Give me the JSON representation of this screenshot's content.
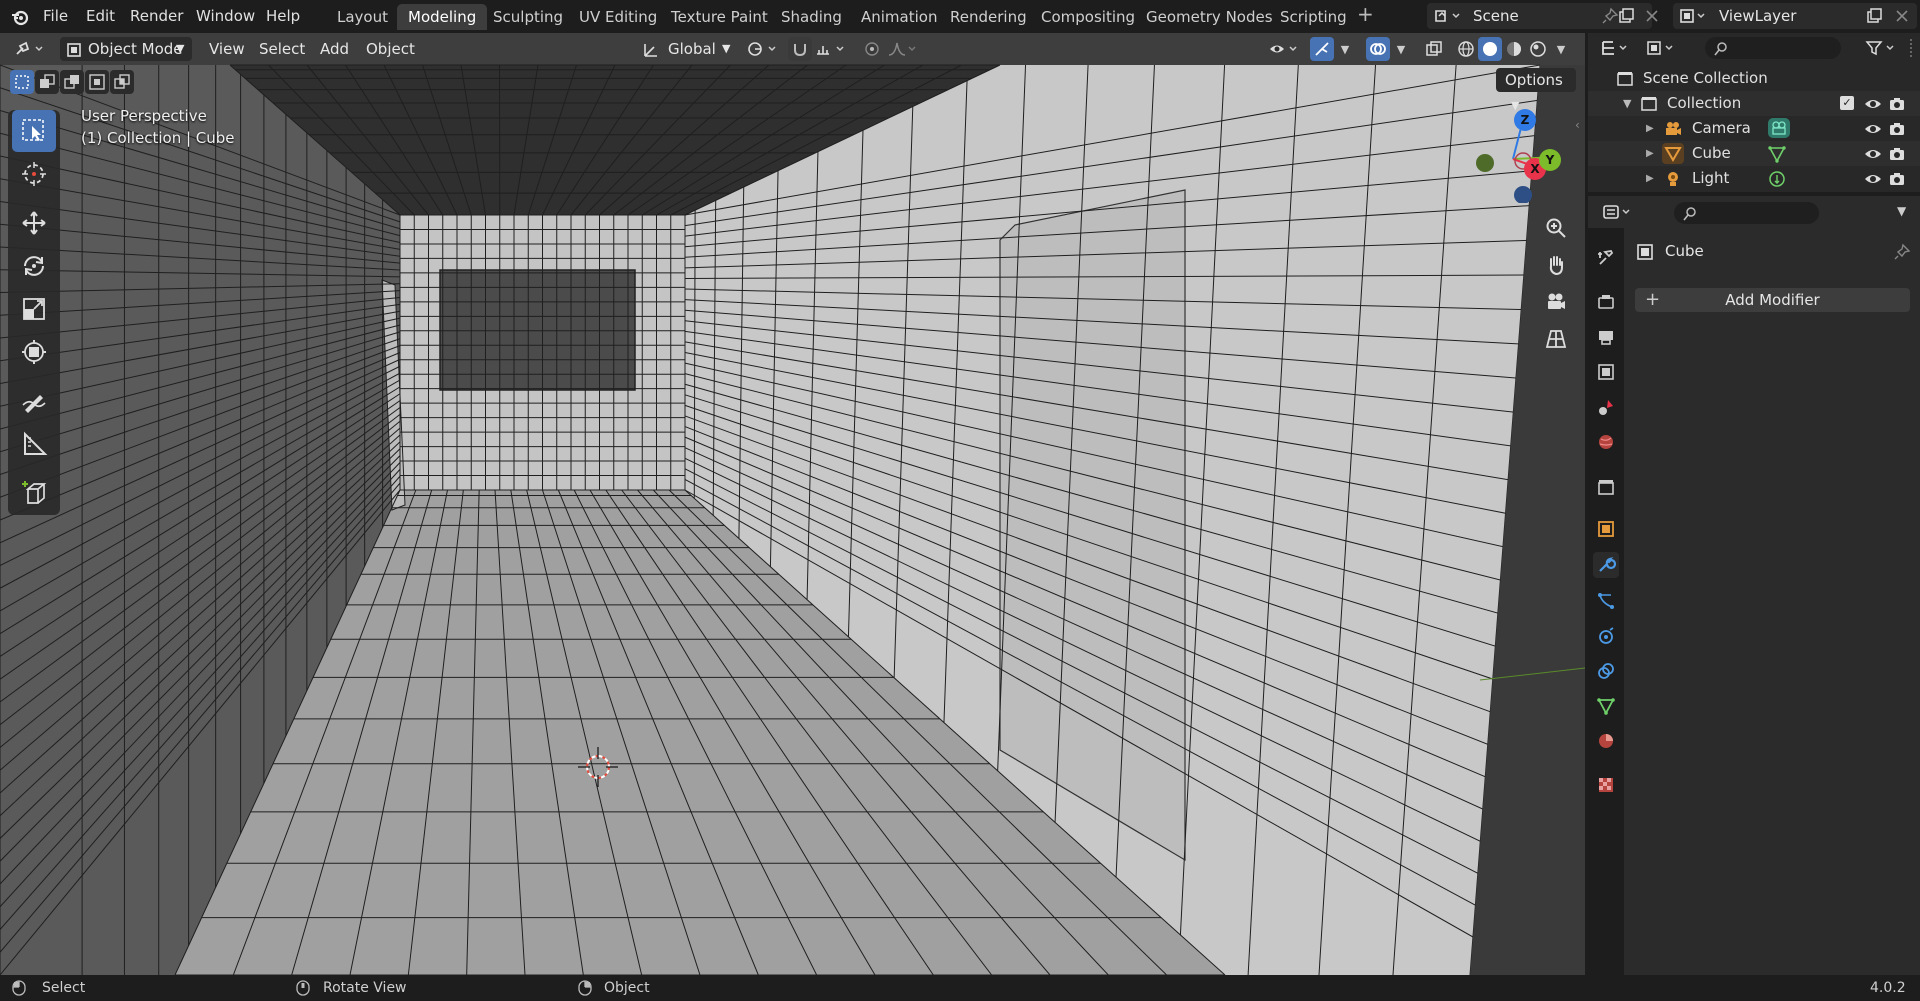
{
  "topbar": {
    "menus": [
      "File",
      "Edit",
      "Render",
      "Window",
      "Help"
    ],
    "workspaces": [
      "Layout",
      "Modeling",
      "Sculpting",
      "UV Editing",
      "Texture Paint",
      "Shading",
      "Animation",
      "Rendering",
      "Compositing",
      "Geometry Nodes",
      "Scripting"
    ],
    "active_workspace": "Modeling",
    "add_workspace": "+",
    "scene_label": "Scene",
    "viewlayer_label": "ViewLayer"
  },
  "viewport_header": {
    "mode": "Object Mode",
    "menus": [
      "View",
      "Select",
      "Add",
      "Object"
    ],
    "orientation": "Global",
    "options": "Options"
  },
  "viewport": {
    "perspective": "User Perspective",
    "context": "(1) Collection | Cube",
    "gizmo": {
      "z": "Z",
      "x": "X",
      "y": "Y"
    }
  },
  "outliner": {
    "root": "Scene Collection",
    "collection": "Collection",
    "items": [
      {
        "label": "Camera",
        "type": "camera"
      },
      {
        "label": "Cube",
        "type": "mesh"
      },
      {
        "label": "Light",
        "type": "light"
      }
    ]
  },
  "properties": {
    "object_name": "Cube",
    "add_modifier": "Add Modifier"
  },
  "statusbar": {
    "select": "Select",
    "rotate": "Rotate View",
    "object": "Object",
    "version": "4.0.2"
  },
  "colors": {
    "accent": "#4772b3",
    "axis_x": "#e8334b",
    "axis_y": "#7cbc2a",
    "axis_z": "#2f7ae5",
    "background": "#1d1d1d"
  }
}
